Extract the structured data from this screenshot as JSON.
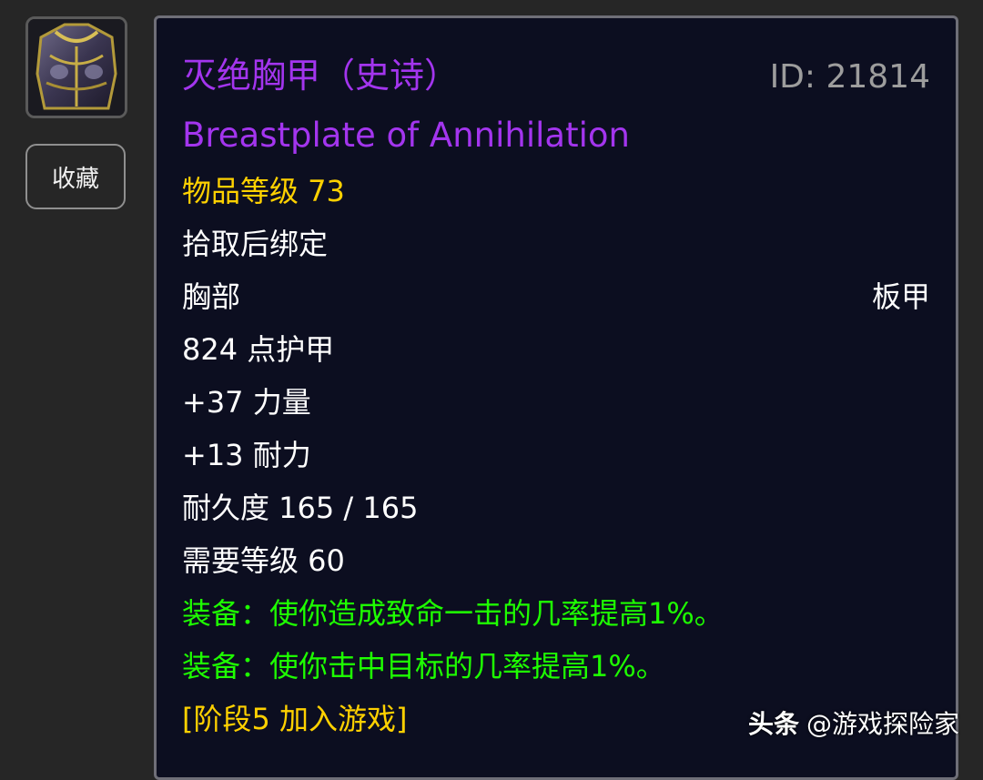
{
  "sidebar": {
    "icon": "breastplate-item-icon",
    "favorite_label": "收藏"
  },
  "item": {
    "name_cn": "灭绝胸甲（史诗）",
    "id_label": "ID: 21814",
    "name_en": "Breastplate of Annihilation",
    "item_level": "物品等级 73",
    "bind": "拾取后绑定",
    "slot": "胸部",
    "armor_type": "板甲",
    "armor": "824 点护甲",
    "strength": "+37 力量",
    "stamina": "+13 耐力",
    "durability": "耐久度 165 / 165",
    "required_level": "需要等级 60",
    "equip_crit": "装备：使你造成致命一击的几率提高1%。",
    "equip_hit": "装备：使你击中目标的几率提高1%。",
    "phase": "[阶段5 加入游戏]"
  },
  "watermark": {
    "brand": "头条",
    "account": "@游戏探险家"
  },
  "colors": {
    "epic": "#a335ee",
    "item_level": "#ffd100",
    "equip_effect": "#1eff00",
    "id_text": "#9d9d9d",
    "panel_bg": "#0c0e20",
    "page_bg": "#262626"
  }
}
